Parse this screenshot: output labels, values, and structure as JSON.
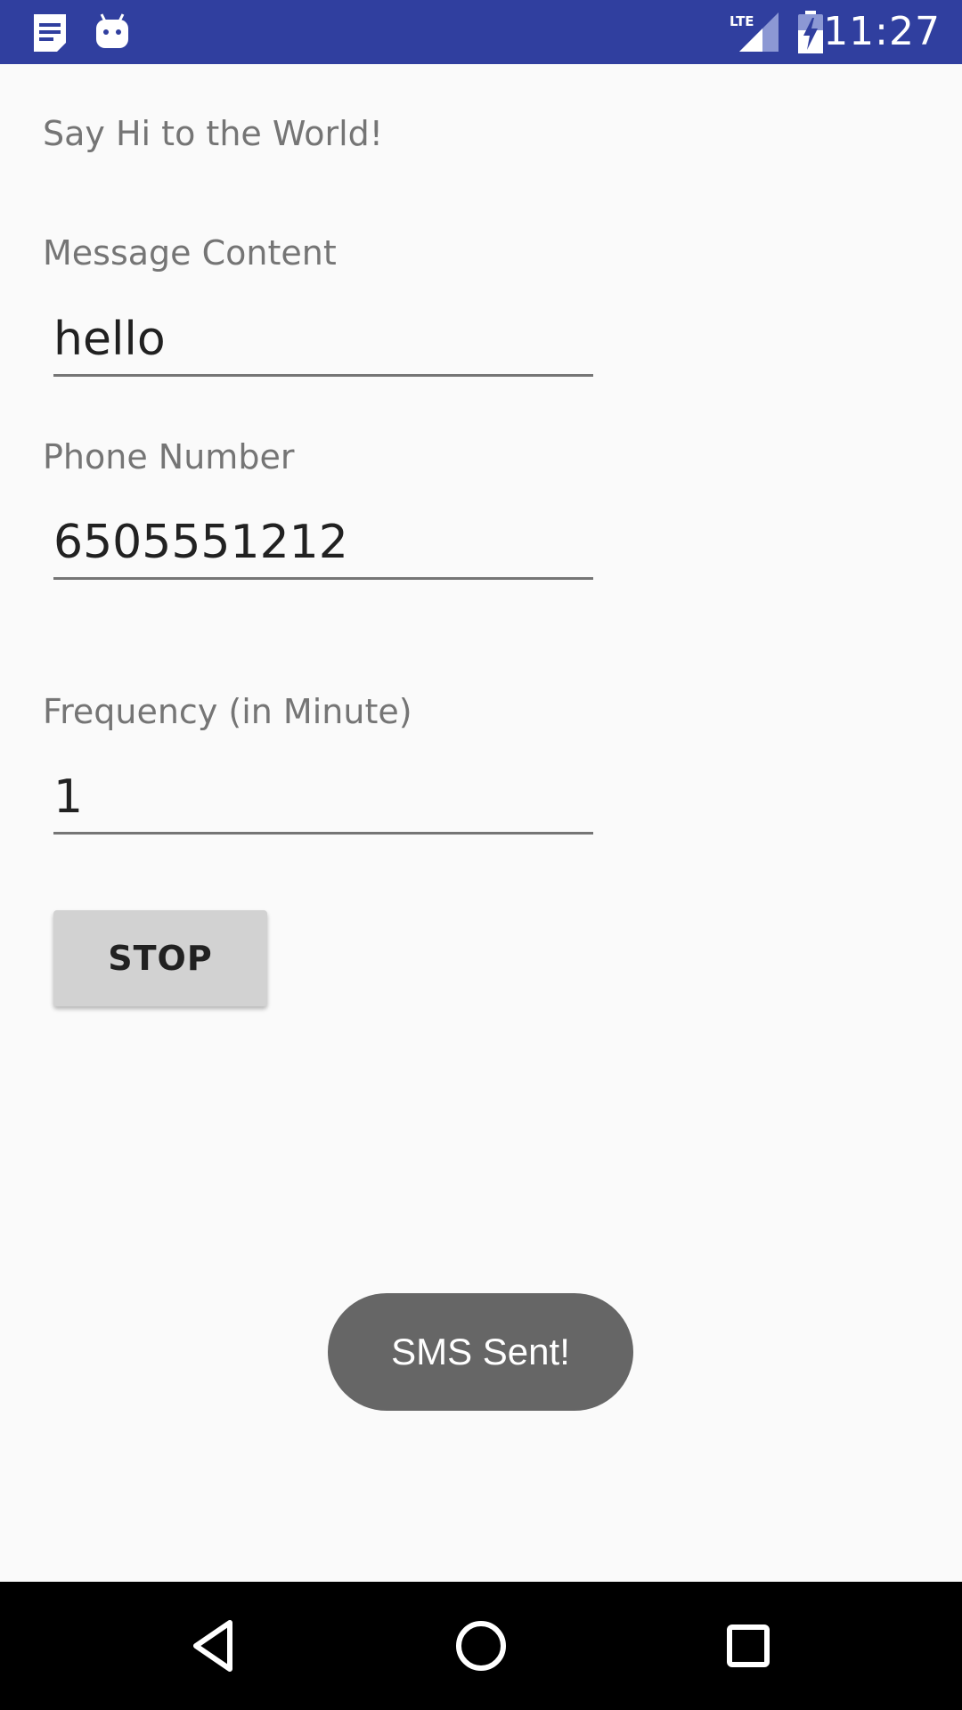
{
  "status_bar": {
    "time": "11:27",
    "network_type": "LTE",
    "icons": [
      "notes-notification-icon",
      "android-notification-icon",
      "lte-signal-icon",
      "battery-charging-icon"
    ],
    "color": "#303f9f"
  },
  "app": {
    "title": "Say Hi to the World!"
  },
  "form": {
    "message_label": "Message Content",
    "message_value": "hello",
    "phone_label": "Phone Number",
    "phone_value": "6505551212",
    "frequency_label": "Frequency (in Minute)",
    "frequency_value": "1"
  },
  "actions": {
    "stop_label": "STOP"
  },
  "toast": {
    "text": "SMS Sent!"
  },
  "nav_bar": {
    "icons": [
      "back-icon",
      "home-icon",
      "recents-icon"
    ]
  }
}
